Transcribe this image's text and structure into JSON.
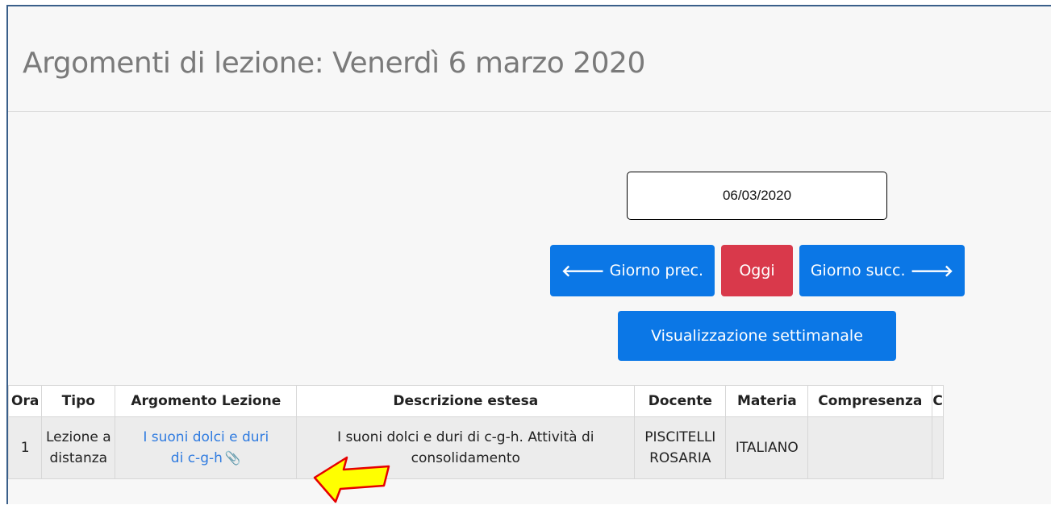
{
  "header": {
    "title": "Argomenti di lezione: Venerdì 6 marzo 2020"
  },
  "date_picker": {
    "value": "06/03/2020"
  },
  "nav": {
    "prev_label": "Giorno prec.",
    "today_label": "Oggi",
    "next_label": "Giorno succ.",
    "weekly_label": "Visualizzazione settimanale",
    "prev_icon": "arrow-left-icon",
    "next_icon": "arrow-right-icon"
  },
  "table": {
    "columns": [
      "Ora",
      "Tipo",
      "Argomento Lezione",
      "Descrizione estesa",
      "Docente",
      "Materia",
      "Compresenza",
      "C"
    ],
    "rows": [
      {
        "ora": "1",
        "tipo_1": "Lezione a",
        "tipo_2": "distanza",
        "argomento_1": "I suoni dolci e duri",
        "argomento_2": "di c-g-h",
        "argomento_icon": "paperclip-icon",
        "descrizione_1": "I suoni dolci e duri di c-g-h. Attività di",
        "descrizione_2": "consolidamento",
        "docente_1": "PISCITELLI",
        "docente_2": "ROSARIA",
        "materia": "ITALIANO",
        "compresenza": ""
      }
    ]
  },
  "annotation": {
    "icon": "yellow-arrow-pointer-icon",
    "fill": "#ffff00",
    "stroke": "#e60000"
  },
  "colors": {
    "primary": "#0b77e6",
    "danger": "#d9394b",
    "link": "#2f7be0",
    "title": "#7a7a7a"
  }
}
